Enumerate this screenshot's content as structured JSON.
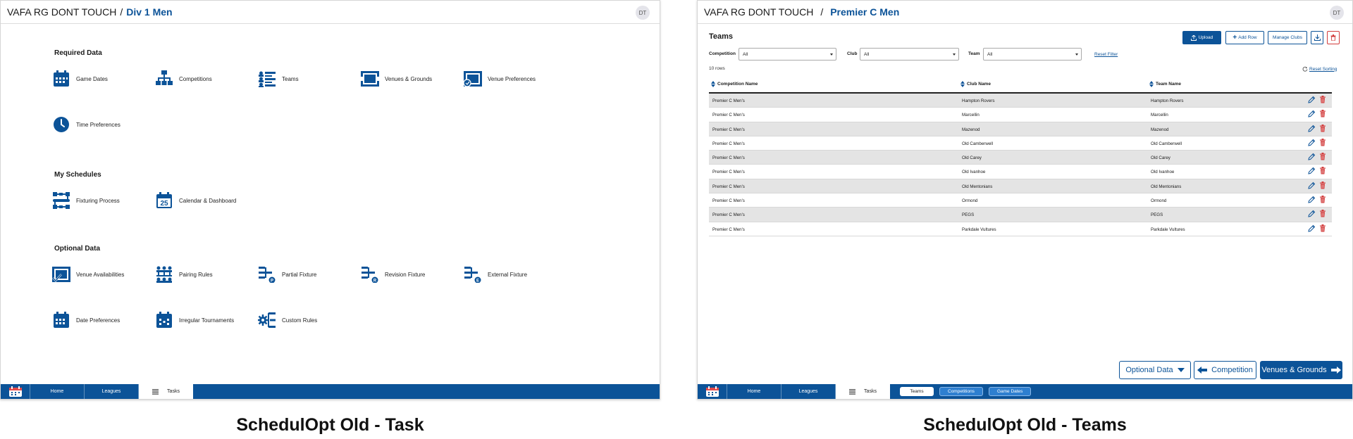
{
  "left": {
    "org": "VAFA RG DONT TOUCH",
    "separator": "/",
    "crumb": "Div 1 Men",
    "avatar": "DT",
    "required_title": "Required Data",
    "required": [
      "Game Dates",
      "Competitions",
      "Teams",
      "Venues & Grounds",
      "Venue Preferences",
      "Time Preferences"
    ],
    "schedules_title": "My Schedules",
    "schedules": [
      "Fixturing Process",
      "Calendar & Dashboard"
    ],
    "calendar_day": "25",
    "optional_title": "Optional Data",
    "optional": [
      "Venue Availabilities",
      "Pairing Rules",
      "Partial Fixture",
      "Revision Fixture",
      "External Fixture",
      "Date Preferences",
      "Irregular Tournaments",
      "Custom Rules"
    ],
    "bottom": {
      "home": "Home",
      "leagues": "Leagues",
      "tasks": "Tasks"
    }
  },
  "right": {
    "org": "VAFA RG DONT TOUCH",
    "separator": "/",
    "crumb": "Premier C Men",
    "avatar": "DT",
    "title": "Teams",
    "toolbar": {
      "upload": "Upload",
      "add_row": "Add Row",
      "manage_clubs": "Manage Clubs"
    },
    "filters": {
      "competition_label": "Competition",
      "competition_value": "All",
      "club_label": "Club",
      "club_value": "All",
      "team_label": "Team",
      "team_value": "All",
      "reset_filter": "Reset Filter"
    },
    "rows_count": "10 rows",
    "reset_sorting": "Reset Sorting",
    "columns": [
      "Competition Name",
      "Club Name",
      "Team Name"
    ],
    "rows": [
      [
        "Premier C Men's",
        "Hampton Rovers",
        "Hampton Rovers"
      ],
      [
        "Premier C Men's",
        "Marcellin",
        "Marcellin"
      ],
      [
        "Premier C Men's",
        "Mazenod",
        "Mazenod"
      ],
      [
        "Premier C Men's",
        "Old Camberwell",
        "Old Camberwell"
      ],
      [
        "Premier C Men's",
        "Old Carey",
        "Old Carey"
      ],
      [
        "Premier C Men's",
        "Old Ivanhoe",
        "Old Ivanhoe"
      ],
      [
        "Premier C Men's",
        "Old Mentonians",
        "Old Mentonians"
      ],
      [
        "Premier C Men's",
        "Ormond",
        "Ormond"
      ],
      [
        "Premier C Men's",
        "PEGS",
        "PEGS"
      ],
      [
        "Premier C Men's",
        "Parkdale Vultures",
        "Parkdale Vultures"
      ]
    ],
    "nav": {
      "optional": "Optional Data",
      "prev": "Competition",
      "next": "Venues & Grounds"
    },
    "bottom": {
      "home": "Home",
      "leagues": "Leagues",
      "tasks": "Tasks",
      "p1": "Teams",
      "p2": "Competitions",
      "p3": "Game Dates"
    }
  },
  "captions": {
    "left": "SchedulOpt Old - Task",
    "right": "SchedulOpt Old - Teams"
  },
  "colors": {
    "brand": "#0c5398",
    "danger": "#d23c3c",
    "row_alt": "#e4e4e4"
  }
}
